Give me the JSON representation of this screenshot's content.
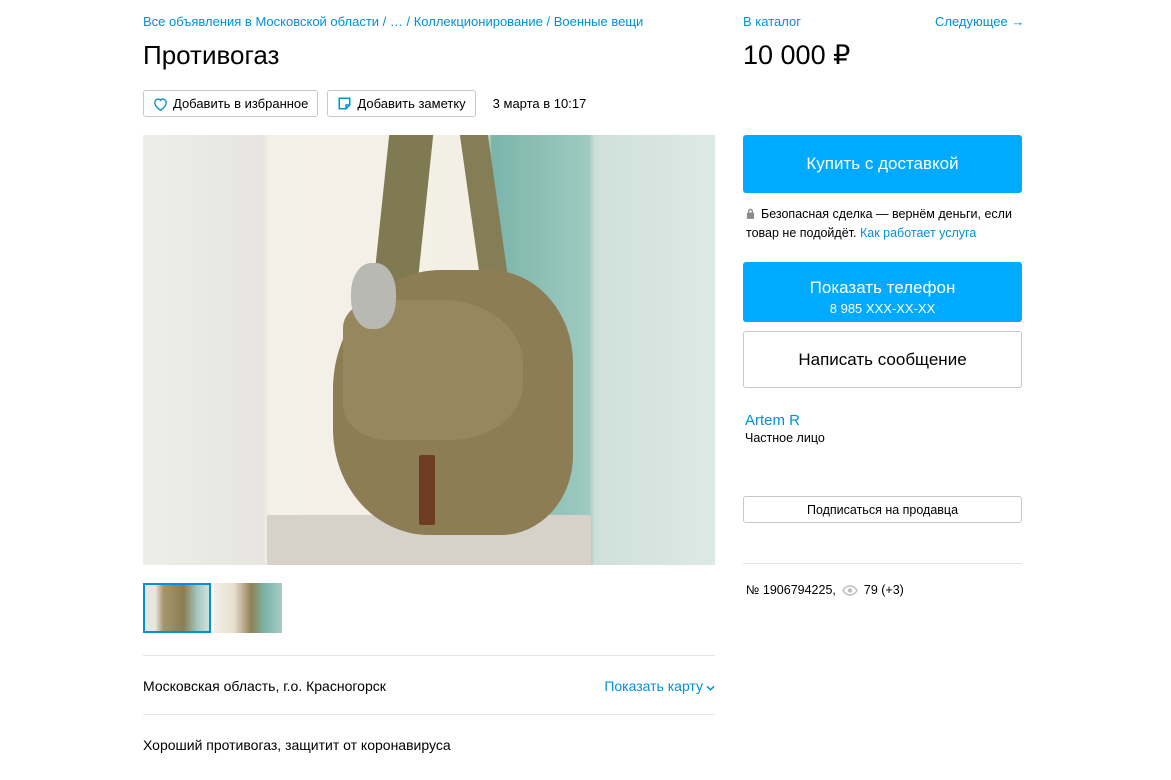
{
  "breadcrumb": {
    "item1": "Все объявления в Московской области",
    "sep": " / ",
    "item2": "…",
    "item3": "Коллекционирование",
    "item4": "Военные вещи"
  },
  "title": "Противогаз",
  "actions": {
    "favorite_label": "Добавить в избранное",
    "note_label": "Добавить заметку",
    "date": "3 марта в 10:17"
  },
  "gallery": {
    "thumbnails": [
      "photo-1",
      "photo-2"
    ],
    "active_index": 0
  },
  "location": {
    "address": "Московская область, г.о. Красногорск",
    "map_link": "Показать карту"
  },
  "description": "Хороший противогаз, защитит от коронавируса",
  "sidebar": {
    "catalog_link": "В каталог",
    "next_link": "Следующее →",
    "price": "10 000 ₽",
    "buy_button": "Купить с доставкой",
    "safe_deal_text": "Безопасная сделка — вернём деньги, если товар не подойдёт.",
    "safe_deal_link": "Как работает услуга",
    "phone_button": "Показать телефон",
    "phone_number": "8 985 XXX-XX-XX",
    "message_button": "Написать сообщение",
    "seller_name": "Artem R",
    "seller_type": "Частное лицо",
    "subscribe_button": "Подписаться на продавца",
    "ad_number": "№ 1906794225,",
    "views": "79 (+3)"
  },
  "colors": {
    "accent": "#00aaff",
    "link": "#0091d9",
    "border": "#c7c7c7"
  }
}
